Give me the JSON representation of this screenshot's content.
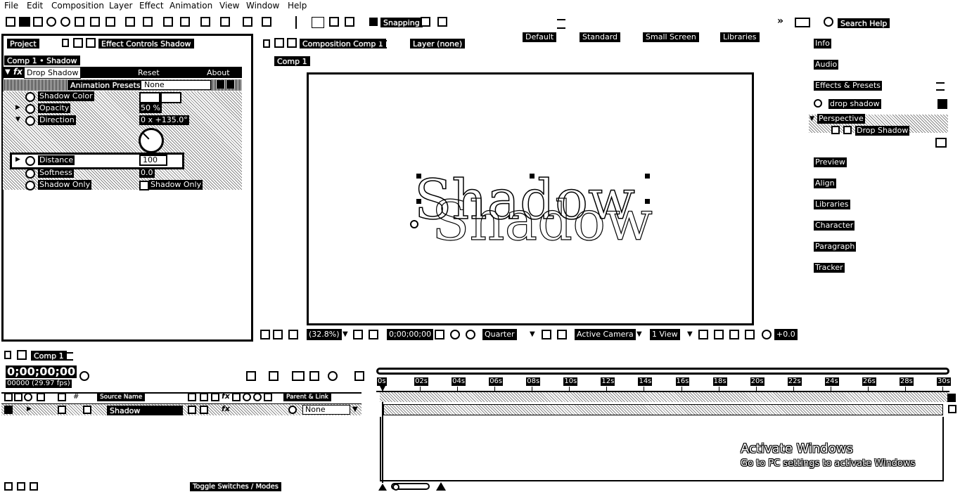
{
  "menu": [
    "File",
    "Edit",
    "Composition",
    "Layer",
    "Effect",
    "Animation",
    "View",
    "Window",
    "Help"
  ],
  "toolbar": {
    "snapping_label": "Snapping",
    "workspaces": [
      "Default",
      "Standard",
      "Small Screen",
      "Libraries"
    ],
    "search_help": "Search Help"
  },
  "left_panel": {
    "tabs": [
      "Project",
      "Effect Controls Shadow"
    ],
    "breadcrumb": "Comp 1 • Shadow",
    "effect_name": "Drop Shadow",
    "reset_label": "Reset",
    "about_label": "About",
    "presets_label": "Animation Presets:",
    "presets_value": "None",
    "properties": [
      {
        "name": "Shadow Color",
        "value": ""
      },
      {
        "name": "Opacity",
        "value": "50 %"
      },
      {
        "name": "Direction",
        "value": "0 x +135.0°"
      },
      {
        "name": "Distance",
        "value": "100"
      },
      {
        "name": "Softness",
        "value": "0.0"
      },
      {
        "name": "Shadow Only",
        "value": "Shadow Only"
      }
    ]
  },
  "composition": {
    "tab_label": "Composition Comp 1",
    "layer_label": "Layer (none)",
    "comp_breadcrumb": "Comp 1",
    "canvas_text": "Shadow",
    "viewer_controls": {
      "zoom": "(32.8%)",
      "timecode": "0;00;00;00",
      "resolution": "Quarter",
      "camera": "Active Camera",
      "views": "1 View",
      "exposure": "+0.0"
    }
  },
  "right_panel": {
    "items_top": [
      "Info",
      "Audio",
      "Effects & Presets"
    ],
    "search_value": "drop shadow",
    "tree_category": "Perspective",
    "tree_item": "Drop Shadow",
    "items_bottom": [
      "Preview",
      "Align",
      "Libraries",
      "Character",
      "Paragraph",
      "Tracker"
    ]
  },
  "timeline": {
    "tab_label": "Comp 1",
    "timecode": "0;00;00;00",
    "fps_label": "00000 (29.97 fps)",
    "col_source_name": "Source Name",
    "col_parent": "Parent & Link",
    "layer_name": "Shadow",
    "layer_parent": "None",
    "ticks": [
      "0s",
      "02s",
      "04s",
      "06s",
      "08s",
      "10s",
      "12s",
      "14s",
      "16s",
      "18s",
      "20s",
      "22s",
      "24s",
      "26s",
      "28s",
      "30s"
    ],
    "toggle_label": "Toggle Switches / Modes"
  },
  "watermark": {
    "title": "Activate Windows",
    "subtitle": "Go to PC settings to activate Windows"
  }
}
